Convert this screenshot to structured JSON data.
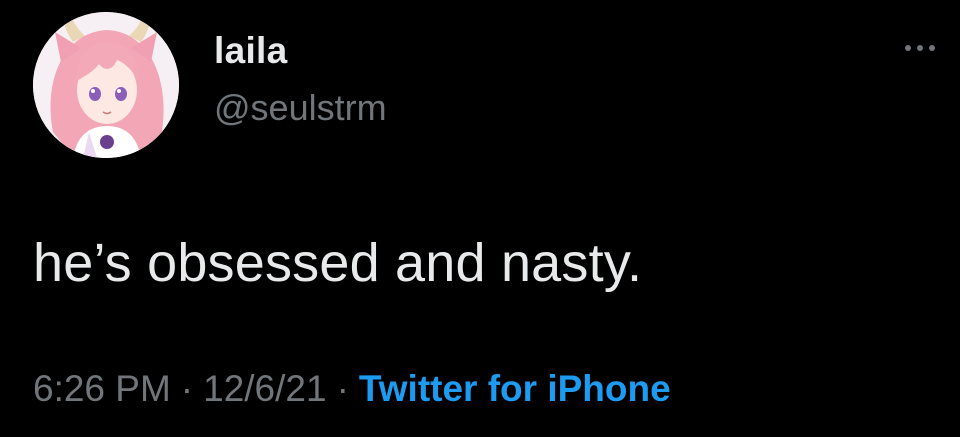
{
  "tweet": {
    "user": {
      "display_name": "laila",
      "handle": "@seulstrm",
      "avatar_icon": "anime-character-avatar"
    },
    "more_icon": "ellipsis-icon",
    "text": "he’s obsessed and nasty.",
    "meta": {
      "time": "6:26 PM",
      "separator": "·",
      "date": "12/6/21",
      "source": "Twitter for iPhone"
    }
  },
  "colors": {
    "background": "#000000",
    "primary_text": "#e7e9ea",
    "secondary_text": "#71767b",
    "link": "#1d9bf0"
  }
}
